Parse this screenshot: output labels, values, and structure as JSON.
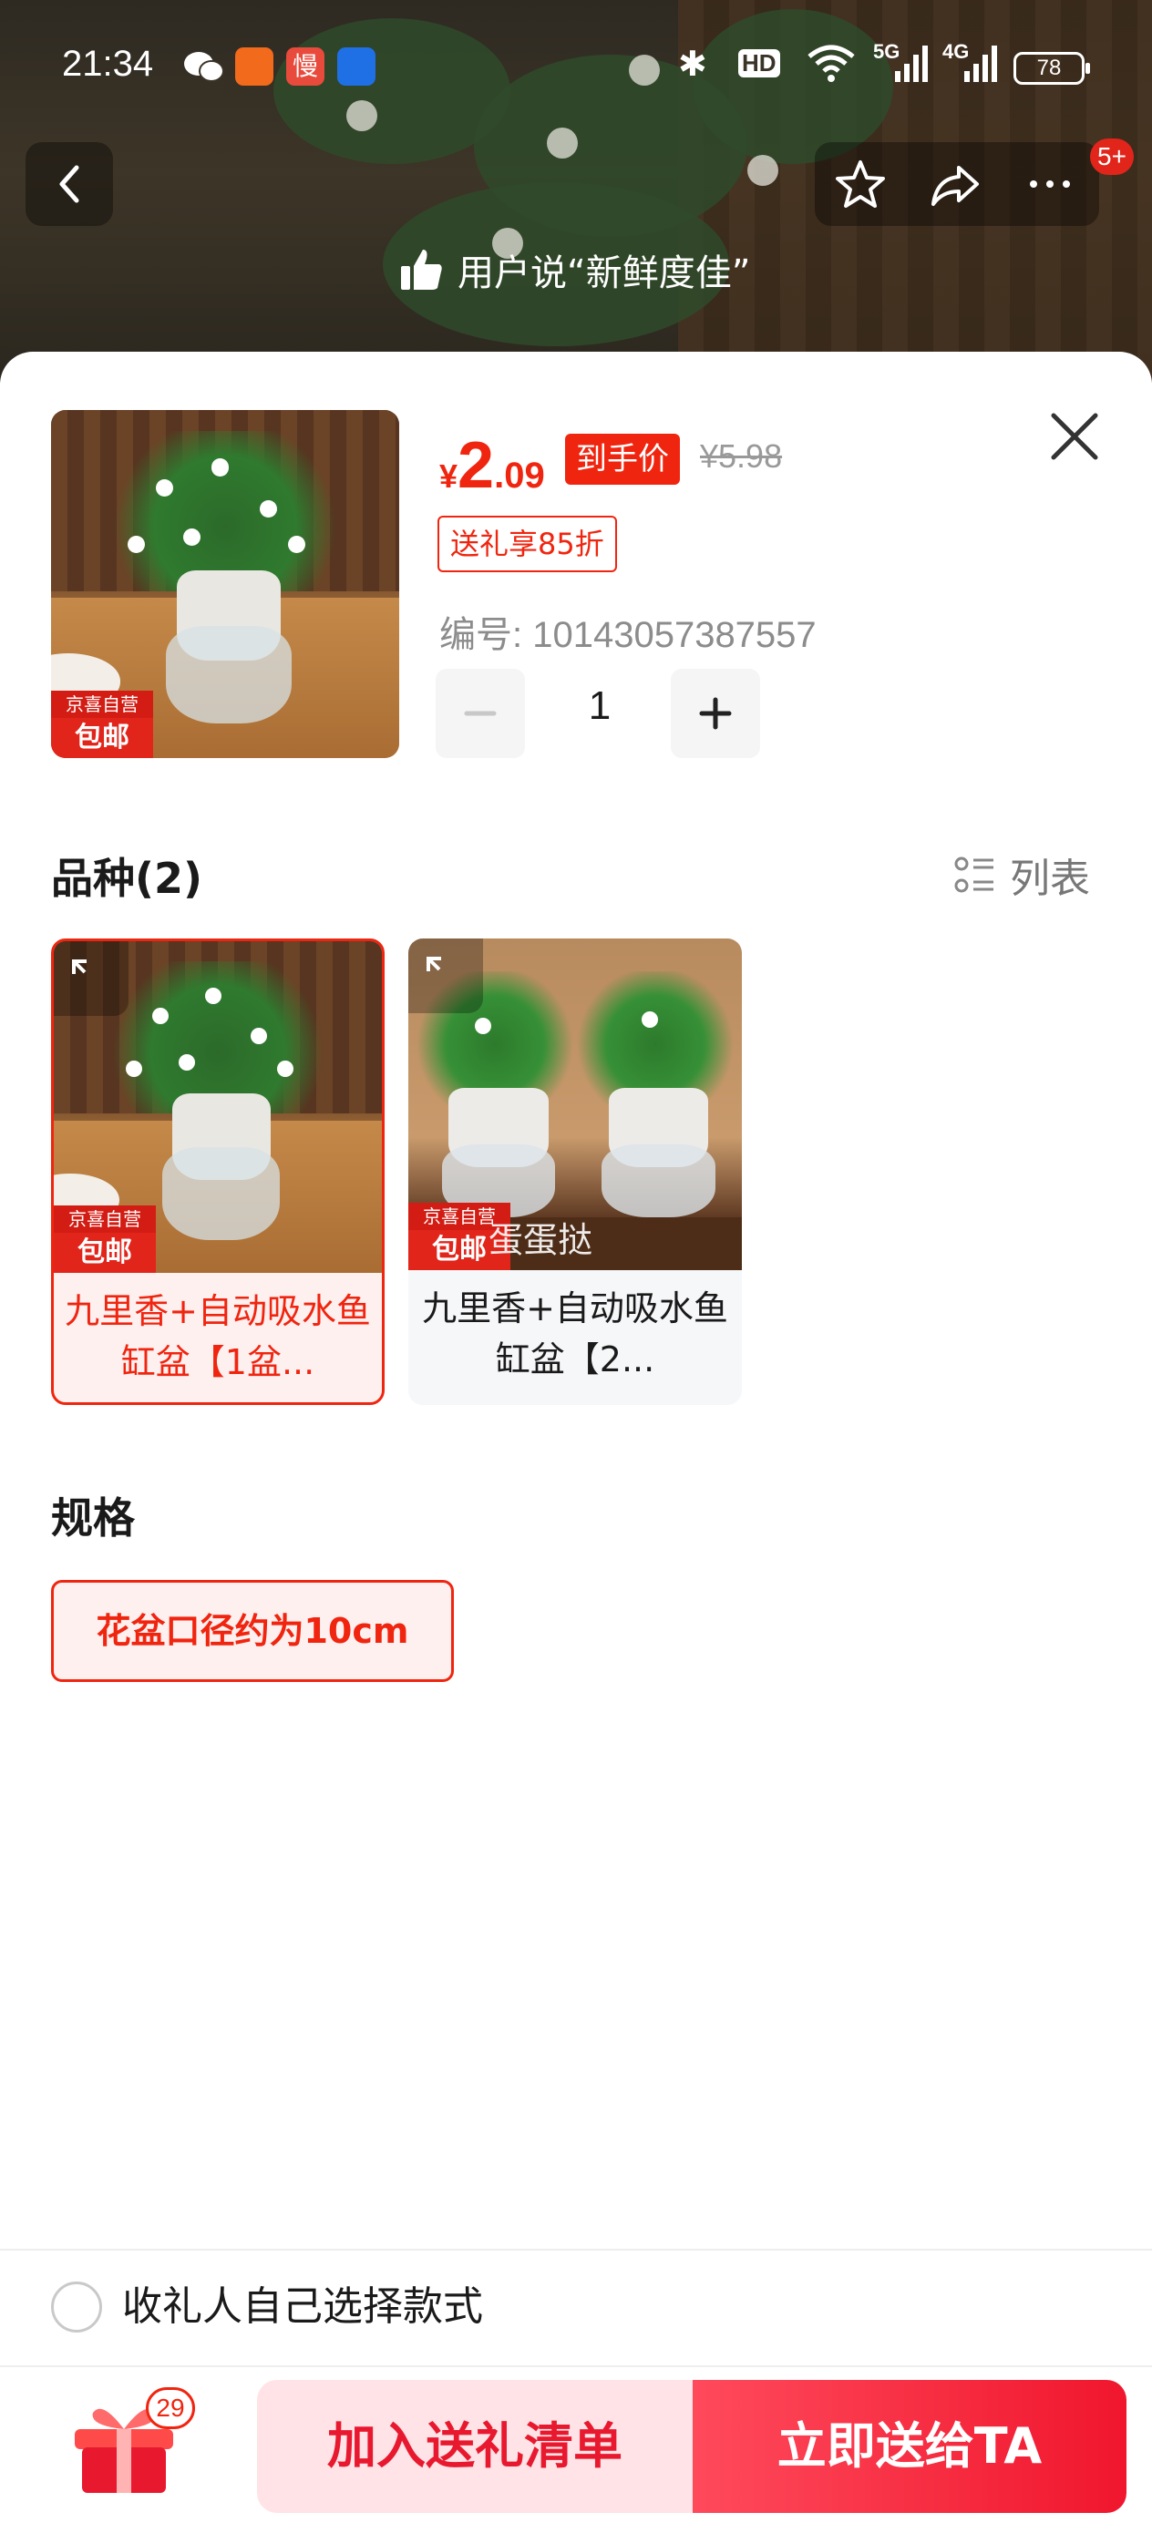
{
  "status_bar": {
    "time": "21:34",
    "network_5g": "5G",
    "network_4g": "4G",
    "hd_label": "HD",
    "battery": "78"
  },
  "nav": {
    "badge": "5+"
  },
  "banner": {
    "user_says": "用户说“新鲜度佳”"
  },
  "product": {
    "price_symbol": "¥",
    "price_int": "2",
    "price_dec": ".09",
    "price_tag": "到手价",
    "original_price": "¥5.98",
    "gift_discount": "送礼享85折",
    "sku": "编号: 10143057387557",
    "quantity": "1",
    "ribbon_top": "京喜自营",
    "ribbon_bottom": "包邮"
  },
  "variants_section": {
    "title": "品种(2)",
    "list_toggle": "列表",
    "items": [
      {
        "label": "九里香+自动吸水鱼缸盆【1盆...",
        "ribbon_top": "京喜自营",
        "ribbon_bottom": "包邮",
        "selected": true
      },
      {
        "label": "九里香+自动吸水鱼缸盆【2...",
        "ribbon_top": "京喜自营",
        "ribbon_bottom": "包邮",
        "watermark": "蛋蛋挞",
        "selected": false
      }
    ]
  },
  "spec_section": {
    "title": "规格",
    "option": "花盆口径约为10cm"
  },
  "recipient_option": {
    "label": "收礼人自己选择款式"
  },
  "footer": {
    "gift_count": "29",
    "add_button": "加入送礼清单",
    "send_button": "立即送给TA"
  },
  "colors": {
    "accent": "#f0250f",
    "accent_light": "#fff0f0",
    "add_bg": "#ffe3e6"
  }
}
